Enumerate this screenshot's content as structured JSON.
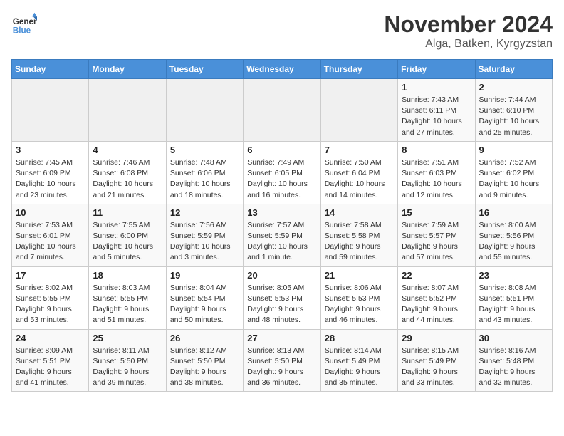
{
  "logo": {
    "line1": "General",
    "line2": "Blue"
  },
  "title": "November 2024",
  "location": "Alga, Batken, Kyrgyzstan",
  "weekdays": [
    "Sunday",
    "Monday",
    "Tuesday",
    "Wednesday",
    "Thursday",
    "Friday",
    "Saturday"
  ],
  "weeks": [
    [
      {
        "day": "",
        "info": ""
      },
      {
        "day": "",
        "info": ""
      },
      {
        "day": "",
        "info": ""
      },
      {
        "day": "",
        "info": ""
      },
      {
        "day": "",
        "info": ""
      },
      {
        "day": "1",
        "info": "Sunrise: 7:43 AM\nSunset: 6:11 PM\nDaylight: 10 hours and 27 minutes."
      },
      {
        "day": "2",
        "info": "Sunrise: 7:44 AM\nSunset: 6:10 PM\nDaylight: 10 hours and 25 minutes."
      }
    ],
    [
      {
        "day": "3",
        "info": "Sunrise: 7:45 AM\nSunset: 6:09 PM\nDaylight: 10 hours and 23 minutes."
      },
      {
        "day": "4",
        "info": "Sunrise: 7:46 AM\nSunset: 6:08 PM\nDaylight: 10 hours and 21 minutes."
      },
      {
        "day": "5",
        "info": "Sunrise: 7:48 AM\nSunset: 6:06 PM\nDaylight: 10 hours and 18 minutes."
      },
      {
        "day": "6",
        "info": "Sunrise: 7:49 AM\nSunset: 6:05 PM\nDaylight: 10 hours and 16 minutes."
      },
      {
        "day": "7",
        "info": "Sunrise: 7:50 AM\nSunset: 6:04 PM\nDaylight: 10 hours and 14 minutes."
      },
      {
        "day": "8",
        "info": "Sunrise: 7:51 AM\nSunset: 6:03 PM\nDaylight: 10 hours and 12 minutes."
      },
      {
        "day": "9",
        "info": "Sunrise: 7:52 AM\nSunset: 6:02 PM\nDaylight: 10 hours and 9 minutes."
      }
    ],
    [
      {
        "day": "10",
        "info": "Sunrise: 7:53 AM\nSunset: 6:01 PM\nDaylight: 10 hours and 7 minutes."
      },
      {
        "day": "11",
        "info": "Sunrise: 7:55 AM\nSunset: 6:00 PM\nDaylight: 10 hours and 5 minutes."
      },
      {
        "day": "12",
        "info": "Sunrise: 7:56 AM\nSunset: 5:59 PM\nDaylight: 10 hours and 3 minutes."
      },
      {
        "day": "13",
        "info": "Sunrise: 7:57 AM\nSunset: 5:59 PM\nDaylight: 10 hours and 1 minute."
      },
      {
        "day": "14",
        "info": "Sunrise: 7:58 AM\nSunset: 5:58 PM\nDaylight: 9 hours and 59 minutes."
      },
      {
        "day": "15",
        "info": "Sunrise: 7:59 AM\nSunset: 5:57 PM\nDaylight: 9 hours and 57 minutes."
      },
      {
        "day": "16",
        "info": "Sunrise: 8:00 AM\nSunset: 5:56 PM\nDaylight: 9 hours and 55 minutes."
      }
    ],
    [
      {
        "day": "17",
        "info": "Sunrise: 8:02 AM\nSunset: 5:55 PM\nDaylight: 9 hours and 53 minutes."
      },
      {
        "day": "18",
        "info": "Sunrise: 8:03 AM\nSunset: 5:55 PM\nDaylight: 9 hours and 51 minutes."
      },
      {
        "day": "19",
        "info": "Sunrise: 8:04 AM\nSunset: 5:54 PM\nDaylight: 9 hours and 50 minutes."
      },
      {
        "day": "20",
        "info": "Sunrise: 8:05 AM\nSunset: 5:53 PM\nDaylight: 9 hours and 48 minutes."
      },
      {
        "day": "21",
        "info": "Sunrise: 8:06 AM\nSunset: 5:53 PM\nDaylight: 9 hours and 46 minutes."
      },
      {
        "day": "22",
        "info": "Sunrise: 8:07 AM\nSunset: 5:52 PM\nDaylight: 9 hours and 44 minutes."
      },
      {
        "day": "23",
        "info": "Sunrise: 8:08 AM\nSunset: 5:51 PM\nDaylight: 9 hours and 43 minutes."
      }
    ],
    [
      {
        "day": "24",
        "info": "Sunrise: 8:09 AM\nSunset: 5:51 PM\nDaylight: 9 hours and 41 minutes."
      },
      {
        "day": "25",
        "info": "Sunrise: 8:11 AM\nSunset: 5:50 PM\nDaylight: 9 hours and 39 minutes."
      },
      {
        "day": "26",
        "info": "Sunrise: 8:12 AM\nSunset: 5:50 PM\nDaylight: 9 hours and 38 minutes."
      },
      {
        "day": "27",
        "info": "Sunrise: 8:13 AM\nSunset: 5:50 PM\nDaylight: 9 hours and 36 minutes."
      },
      {
        "day": "28",
        "info": "Sunrise: 8:14 AM\nSunset: 5:49 PM\nDaylight: 9 hours and 35 minutes."
      },
      {
        "day": "29",
        "info": "Sunrise: 8:15 AM\nSunset: 5:49 PM\nDaylight: 9 hours and 33 minutes."
      },
      {
        "day": "30",
        "info": "Sunrise: 8:16 AM\nSunset: 5:48 PM\nDaylight: 9 hours and 32 minutes."
      }
    ]
  ]
}
